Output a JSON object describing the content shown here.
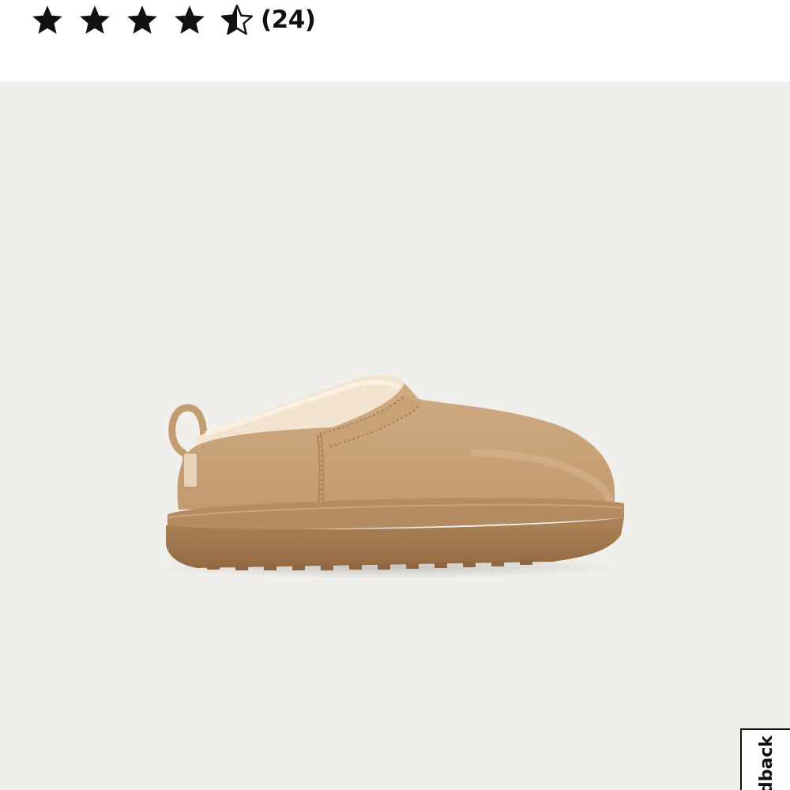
{
  "rating": {
    "value": 4.5,
    "max": 5,
    "review_count_text": "(24)",
    "star_color": "#111111",
    "icons": [
      "star-filled-icon",
      "star-filled-icon",
      "star-filled-icon",
      "star-filled-icon",
      "star-half-icon"
    ]
  },
  "gallery": {
    "background_color": "#f1efeb",
    "product_image": "tan-slipper-clog",
    "product_colors": {
      "suede": "#c9a47b",
      "sole": "#a47a52",
      "lining": "#f4e6d2"
    }
  },
  "feedback_tab": {
    "label": "Feedback",
    "visible_text": "ack"
  }
}
